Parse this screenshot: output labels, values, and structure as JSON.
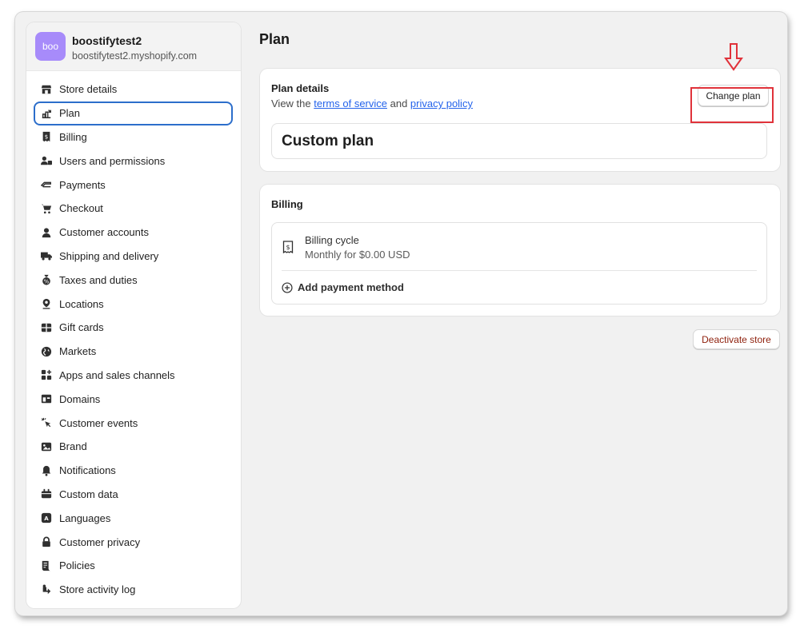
{
  "store": {
    "avatar_text": "boo",
    "name": "boostifytest2",
    "domain": "boostifytest2.myshopify.com"
  },
  "sidebar": {
    "active_item": "Plan",
    "items": [
      {
        "label": "Store details",
        "icon": "store-icon"
      },
      {
        "label": "Plan",
        "icon": "plan-icon"
      },
      {
        "label": "Billing",
        "icon": "receipt-icon"
      },
      {
        "label": "Users and permissions",
        "icon": "users-icon"
      },
      {
        "label": "Payments",
        "icon": "payments-icon"
      },
      {
        "label": "Checkout",
        "icon": "cart-icon"
      },
      {
        "label": "Customer accounts",
        "icon": "person-icon"
      },
      {
        "label": "Shipping and delivery",
        "icon": "truck-icon"
      },
      {
        "label": "Taxes and duties",
        "icon": "money-bag-icon"
      },
      {
        "label": "Locations",
        "icon": "location-pin-icon"
      },
      {
        "label": "Gift cards",
        "icon": "gift-card-icon"
      },
      {
        "label": "Markets",
        "icon": "globe-icon"
      },
      {
        "label": "Apps and sales channels",
        "icon": "apps-icon"
      },
      {
        "label": "Domains",
        "icon": "domain-icon"
      },
      {
        "label": "Customer events",
        "icon": "cursor-click-icon"
      },
      {
        "label": "Brand",
        "icon": "brand-image-icon"
      },
      {
        "label": "Notifications",
        "icon": "bell-icon"
      },
      {
        "label": "Custom data",
        "icon": "database-icon"
      },
      {
        "label": "Languages",
        "icon": "language-icon"
      },
      {
        "label": "Customer privacy",
        "icon": "lock-icon"
      },
      {
        "label": "Policies",
        "icon": "policy-icon"
      },
      {
        "label": "Store activity log",
        "icon": "activity-icon"
      }
    ]
  },
  "main": {
    "title": "Plan",
    "plan_card": {
      "heading": "Plan details",
      "view_prefix": "View the ",
      "terms_link": "terms of service",
      "and_text": " and ",
      "privacy_link": "privacy policy",
      "change_button": "Change plan",
      "plan_name": "Custom plan"
    },
    "billing_card": {
      "heading": "Billing",
      "cycle_label": "Billing cycle",
      "cycle_value": "Monthly for $0.00 USD",
      "add_payment": "Add payment method"
    },
    "deactivate_button": "Deactivate store"
  },
  "colors": {
    "accent": "#2c6ecb",
    "link": "#2463eb",
    "annotation": "#e0323a",
    "danger_text": "#8e1f0b",
    "avatar": "#a78bfa"
  }
}
